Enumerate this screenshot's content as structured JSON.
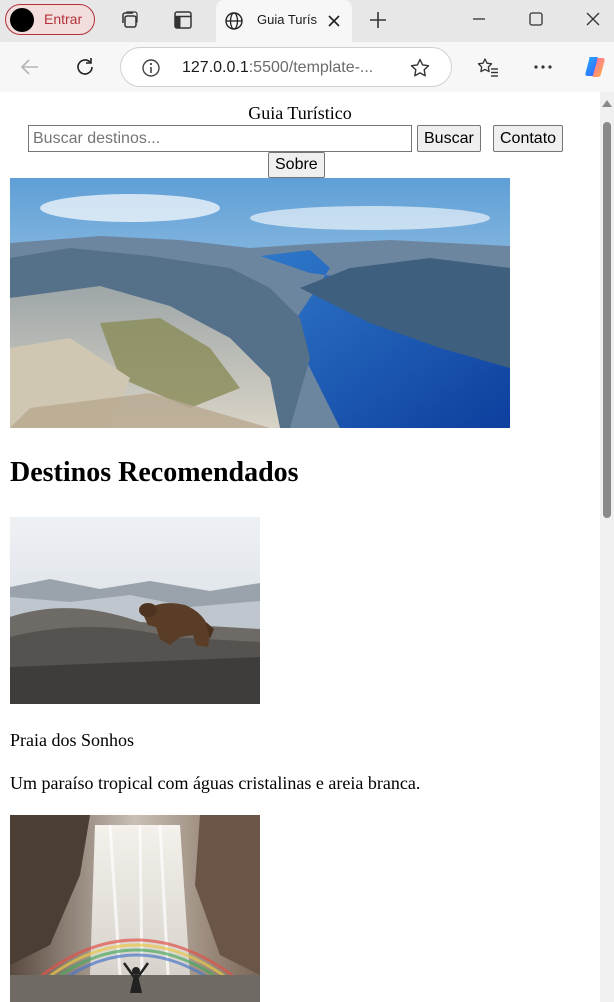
{
  "browser": {
    "profile_label": "Entrar",
    "tab_title": "Guia Turístico",
    "url_host": "127.0.0.1",
    "url_rest": ":5500/template-...",
    "icons": {
      "profile": "avatar",
      "workspaces": "workspaces-icon",
      "tab_actions": "tab-actions-icon",
      "tab_favicon": "globe-icon",
      "tab_close": "close-icon",
      "new_tab": "plus-icon",
      "minimize": "minimize-icon",
      "maximize": "maximize-icon",
      "close_window": "close-icon",
      "back": "back-arrow-icon",
      "reload": "reload-icon",
      "site_info": "info-icon",
      "favorite": "star-icon",
      "favorites": "favorites-icon",
      "menu": "more-icon",
      "copilot": "copilot-icon"
    },
    "colors": {
      "profile_accent": "#b3323a",
      "tab_strip": "#e7e7e7",
      "toolbar": "#f7f7f7"
    }
  },
  "page": {
    "site_title": "Guia Turístico",
    "search": {
      "placeholder": "Buscar destinos..."
    },
    "buttons": {
      "search": "Buscar",
      "contact": "Contato",
      "about": "Sobre"
    },
    "section_title": "Destinos Recomendados",
    "destinations": [
      {
        "name": "Praia dos Sonhos",
        "description": "Um paraíso tropical com águas cristalinas e areia branca."
      },
      {
        "name": "",
        "description": ""
      }
    ]
  }
}
